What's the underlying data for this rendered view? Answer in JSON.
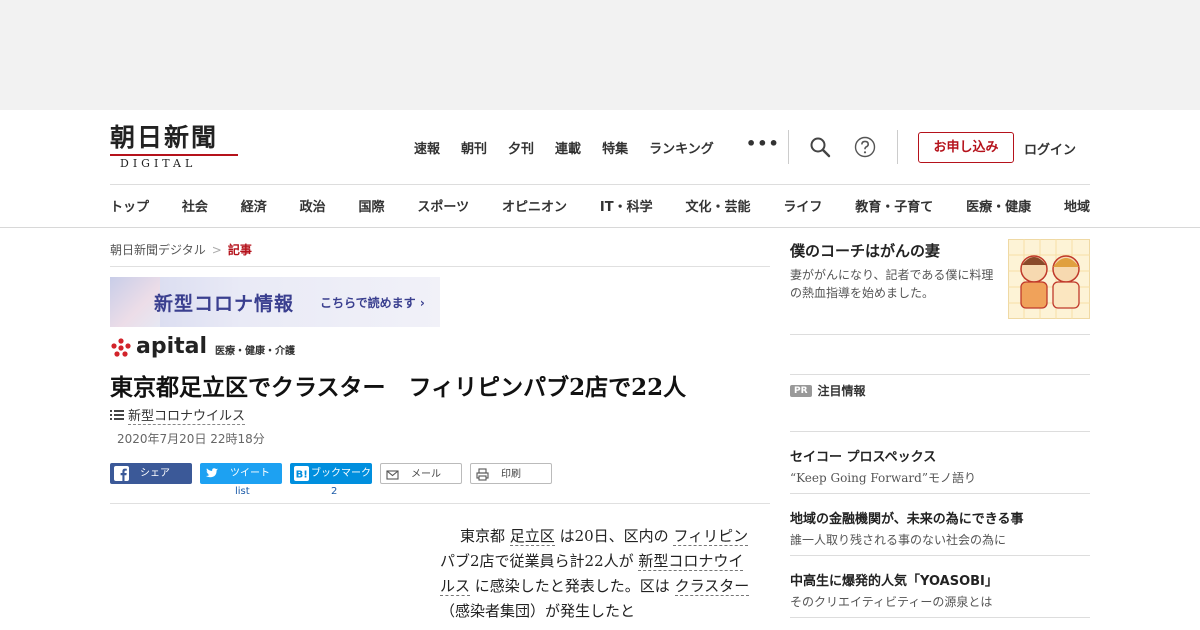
{
  "logo": {
    "main": "朝日新聞",
    "sub": "DIGITAL"
  },
  "topnav": [
    "速報",
    "朝刊",
    "夕刊",
    "連載",
    "特集",
    "ランキング"
  ],
  "header": {
    "more": "•••",
    "apply_label": "お申し込み",
    "login_label": "ログイン"
  },
  "categories": [
    "トップ",
    "社会",
    "経済",
    "政治",
    "国際",
    "スポーツ",
    "オピニオン",
    "IT・科学",
    "文化・芸能",
    "ライフ",
    "教育・子育て",
    "医療・健康",
    "地域"
  ],
  "breadcrumb": {
    "home": "朝日新聞デジタル",
    "sep": ">",
    "current": "記事"
  },
  "corona_banner": {
    "title": "新型コロナ情報",
    "link": "こちらで読めます ›"
  },
  "apital": {
    "word": "apital",
    "sub": "医療・健康・介護"
  },
  "article": {
    "headline": "東京都足立区でクラスター　フィリピンパブ2店で22人",
    "tag": "新型コロナウイルス",
    "date": "2020年7月20日 22時18分",
    "body": {
      "p1": "東京都",
      "l1": "足立区",
      "p2": "は20日、区内の",
      "l2": "フィリピン",
      "p3": "パブ2店で従業員ら計22人が",
      "l3": "新型コロナウイルス",
      "p4": "に感染したと発表した。区は",
      "l4": "クラスター",
      "p5": "（感染者集団）が発生したと"
    }
  },
  "share": {
    "facebook": "シェア",
    "twitter": "ツイート",
    "twitter_count": "list",
    "hatena": "ブックマーク",
    "hatena_count": "2",
    "mail": "メール",
    "print": "印刷"
  },
  "sidebar": {
    "promo_title": "僕のコーチはがんの妻",
    "promo_desc": "妻ががんになり、記者である僕に料理の熱血指導を始めました。",
    "pr_badge": "PR",
    "pr_label": "注目情報",
    "pr_items": [
      {
        "title": "セイコー プロスペックス",
        "desc": "“Keep Going Forward”モノ語り"
      },
      {
        "title": "地域の金融機関が、未来の為にできる事",
        "desc": "誰一人取り残される事のない社会の為に"
      },
      {
        "title": "中高生に爆発的人気「YOASOBI」",
        "desc": "そのクリエイティビティーの源泉とは"
      }
    ]
  },
  "colors": {
    "accent": "#b5121b",
    "facebook": "#3b5998",
    "twitter": "#1da1f2",
    "hatena": "#008fde",
    "corona": "#3a3f8f"
  }
}
